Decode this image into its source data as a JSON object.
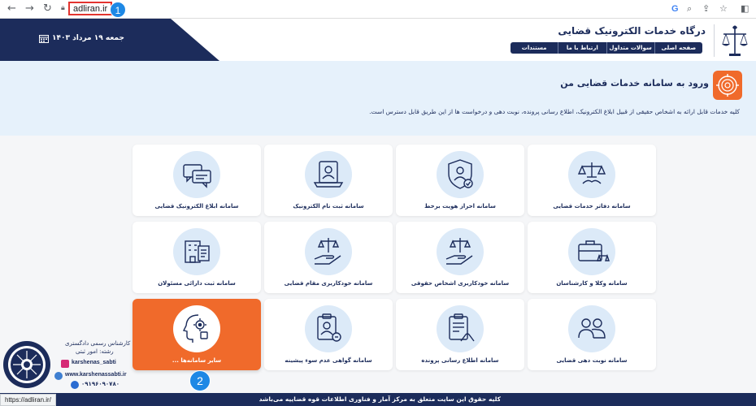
{
  "browser": {
    "url": "adliran.ir",
    "status_url": "https://adliran.ir/"
  },
  "markers": [
    "1",
    "2"
  ],
  "header": {
    "site_title": "درگاه خدمات الکترونیک قضایی",
    "date": "جمعه ۱۹ مرداد ۱۴۰۳",
    "menu": [
      "صفحه اصلی",
      "سوالات متداول",
      "ارتباط با ما",
      "مستندات"
    ]
  },
  "banner": {
    "title": "ورود به سامانه خدمات قضایی من",
    "description": "کلیه خدمات قابل ارائه به اشخاص حقیقی از قبیل ابلاغ الکترونیک، اطلاع رسانی پرونده، نوبت دهی و درخواست ها از این طریق قابل دسترس است."
  },
  "services": [
    {
      "label": "سامانه دفاتر خدمات قضایی",
      "icon": "scales-hands-icon"
    },
    {
      "label": "سامانه احراز هویت برخط",
      "icon": "shield-user-icon"
    },
    {
      "label": "سامانه ثبت نام الکترونیک",
      "icon": "laptop-user-icon"
    },
    {
      "label": "سامانه ابلاغ الکترونیک قضایی",
      "icon": "chat-bubbles-icon"
    },
    {
      "label": "سامانه وکلا و کارشناسان",
      "icon": "briefcase-scales-icon"
    },
    {
      "label": "سامانه خودکاربری اشخاص حقوقی",
      "icon": "hand-scales-icon"
    },
    {
      "label": "سامانه خودکاربری مقام قضایی",
      "icon": "hand-scales-judge-icon"
    },
    {
      "label": "سامانه ثبت دارائی مسئولان",
      "icon": "building-document-icon"
    },
    {
      "label": "سامانه نوبت دهی قضایی",
      "icon": "people-queue-icon"
    },
    {
      "label": "سامانه اطلاع رسانی پرونده",
      "icon": "clipboard-hand-icon"
    },
    {
      "label": "سامانه گواهی عدم سوء پیشینه",
      "icon": "certificate-user-icon"
    },
    {
      "label": "سایر سامانه‌ها ...",
      "icon": "gear-head-icon"
    }
  ],
  "footer": {
    "text": "کلیه حقوق این سایت متعلق به مرکز آمار و فناوری اطلاعات قوه قضاییه می‌باشد"
  },
  "watermark": {
    "line1": "کارشناس رسمی دادگستری",
    "line2": "رشته: امور ثبتی",
    "instagram": "karshenas_sabti",
    "website": "www.karshenassabti.ir",
    "phone": "۰۹۱۹۶۰۹۰۷۸۰"
  },
  "colors": {
    "navy": "#1c2c5b",
    "orange": "#f06a2b",
    "banner_bg": "#e6f1fb",
    "icon_bg": "#dceaf8",
    "highlight_red": "#e3342f",
    "marker_blue": "#1e88e5"
  }
}
